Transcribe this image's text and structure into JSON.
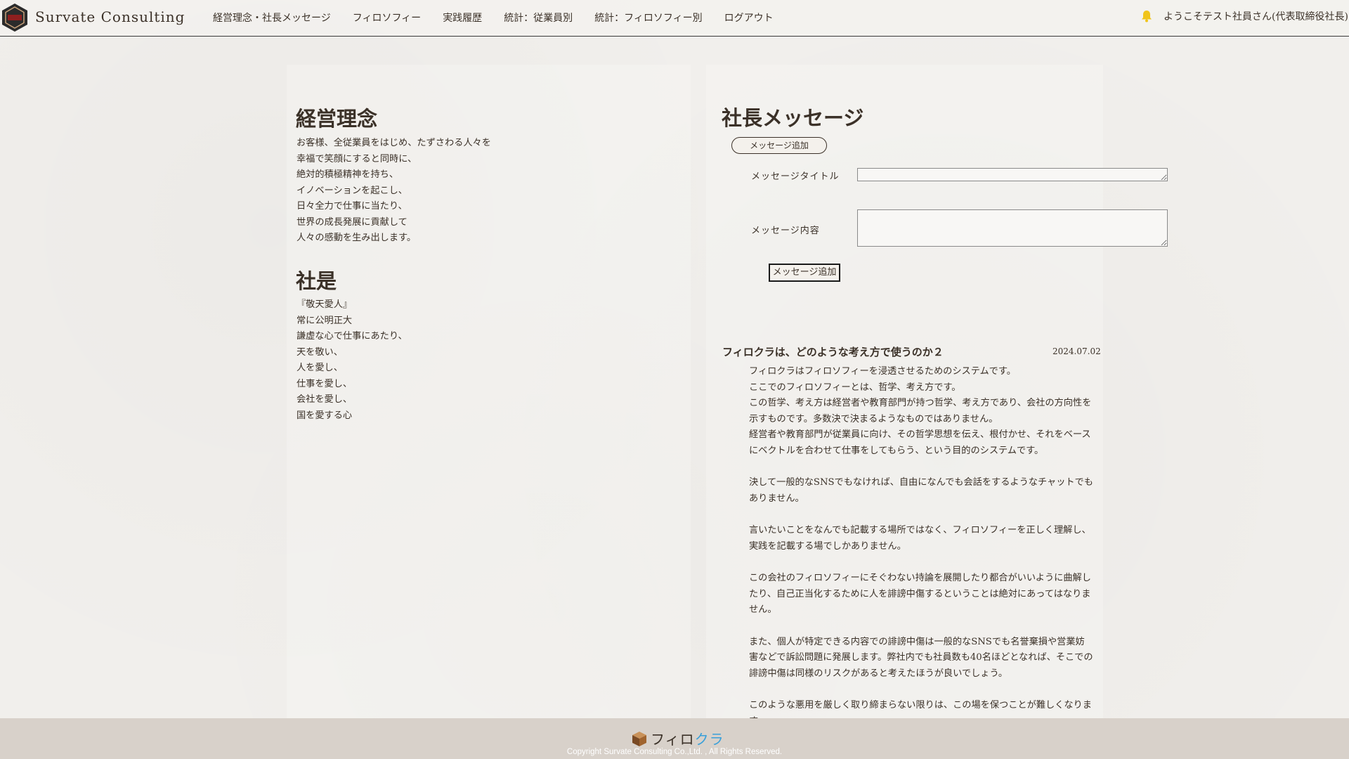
{
  "header": {
    "brand": "Survate Consulting",
    "nav": [
      "経営理念・社長メッセージ",
      "フィロソフィー",
      "実践履歴",
      "統計：従業員別",
      "統計：フィロソフィー別",
      "ログアウト"
    ],
    "welcome": "ようこそテスト社員さん(代表取締役社長)"
  },
  "philosophy": {
    "title": "経営理念",
    "text": "お客様、全従業員をはじめ、たずさわる人々を\n幸福で笑顔にすると同時に、\n絶対的積極精神を持ち、\nイノベーションを起こし、\n日々全力で仕事に当たり、\n世界の成長発展に貢献して\n人々の感動を生み出します。"
  },
  "motto": {
    "title": "社是",
    "text": "『敬天愛人』\n常に公明正大\n謙虚な心で仕事にあたり、\n天を敬い、\n人を愛し、\n仕事を愛し、\n会社を愛し、\n国を愛する心"
  },
  "message": {
    "title": "社長メッセージ",
    "add_toggle_label": "メッセージ追加",
    "form": {
      "title_label": "メッセージタイトル",
      "title_value": "",
      "content_label": "メッセージ内容",
      "content_value": "",
      "submit_label": "メッセージ追加"
    },
    "post": {
      "title": "フィロクラは、どのような考え方で使うのか２",
      "date": "2024.07.02",
      "paragraphs": [
        "フィロクラはフィロソフィーを浸透させるためのシステムです。\nここでのフィロソフィーとは、哲学、考え方です。\nこの哲学、考え方は経営者や教育部門が持つ哲学、考え方であり、会社の方向性を示すものです。多数決で決まるようなものではありません。\n経営者や教育部門が従業員に向け、その哲学思想を伝え、根付かせ、それをベースにベクトルを合わせて仕事をしてもらう、という目的のシステムです。",
        "決して一般的なSNSでもなければ、自由になんでも会話をするようなチャットでもありません。",
        "言いたいことをなんでも記載する場所ではなく、フィロソフィーを正しく理解し、実践を記載する場でしかありません。",
        "この会社のフィロソフィーにそぐわない持論を展開したり都合がいいように曲解したり、自己正当化するために人を誹謗中傷するということは絶対にあってはなりません。",
        "また、個人が特定できる内容での誹謗中傷は一般的なSNSでも名誉棄損や営業妨害などで訴訟問題に発展します。弊社内でも社員数も40名ほどとなれば、そこでの誹謗中傷は同様のリスクがあると考えたほうが良いでしょう。",
        "このような悪用を厳しく取り締まらない限りは、この場を保つことが難しくなります。"
      ]
    }
  },
  "footer": {
    "app_logo_main": "フィロ",
    "app_logo_accent": "クラ",
    "copyright": "Copyright Survate Consulting Co.,Ltd. , All Rights Reserved."
  },
  "icons": {
    "logo": "hexagon-logo-icon",
    "bell": "bell-icon",
    "app_box": "box-icon"
  },
  "colors": {
    "text": "#3b3128",
    "background": "#f1efec",
    "footer": "#d8d1ca",
    "bell": "#f0c419",
    "logo_accent": "#3aa0d9"
  }
}
